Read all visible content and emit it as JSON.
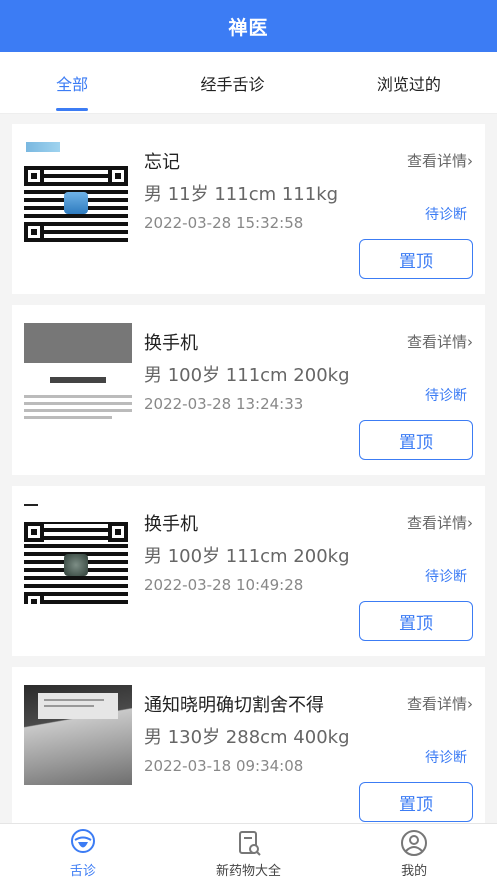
{
  "header": {
    "title": "禅医"
  },
  "tabs": [
    {
      "label": "全部",
      "active": true
    },
    {
      "label": "经手舌诊",
      "active": false
    },
    {
      "label": "浏览过的",
      "active": false
    }
  ],
  "card_labels": {
    "detail": "查看详情",
    "status": "待诊断",
    "pin": "置顶"
  },
  "cards": [
    {
      "title": "忘记",
      "meta": "男 11岁 111cm 111kg",
      "time": "2022-03-28 15:32:58",
      "thumb": "qr-code"
    },
    {
      "title": "换手机",
      "meta": "男 100岁 111cm 200kg",
      "time": "2022-03-28 13:24:33",
      "thumb": "document-photo"
    },
    {
      "title": "换手机",
      "meta": "男 100岁 111cm 200kg",
      "time": "2022-03-28 10:49:28",
      "thumb": "qr-code"
    },
    {
      "title": "通知晓明确切割舍不得",
      "meta": "男 130岁 288cm 400kg",
      "time": "2022-03-18 09:34:08",
      "thumb": "laptop-photo"
    }
  ],
  "nav": [
    {
      "label": "舌诊",
      "icon": "tongue-icon",
      "active": true
    },
    {
      "label": "新药物大全",
      "icon": "medicine-book-icon",
      "active": false
    },
    {
      "label": "我的",
      "icon": "user-icon",
      "active": false
    }
  ],
  "colors": {
    "accent": "#3c7cf4"
  }
}
